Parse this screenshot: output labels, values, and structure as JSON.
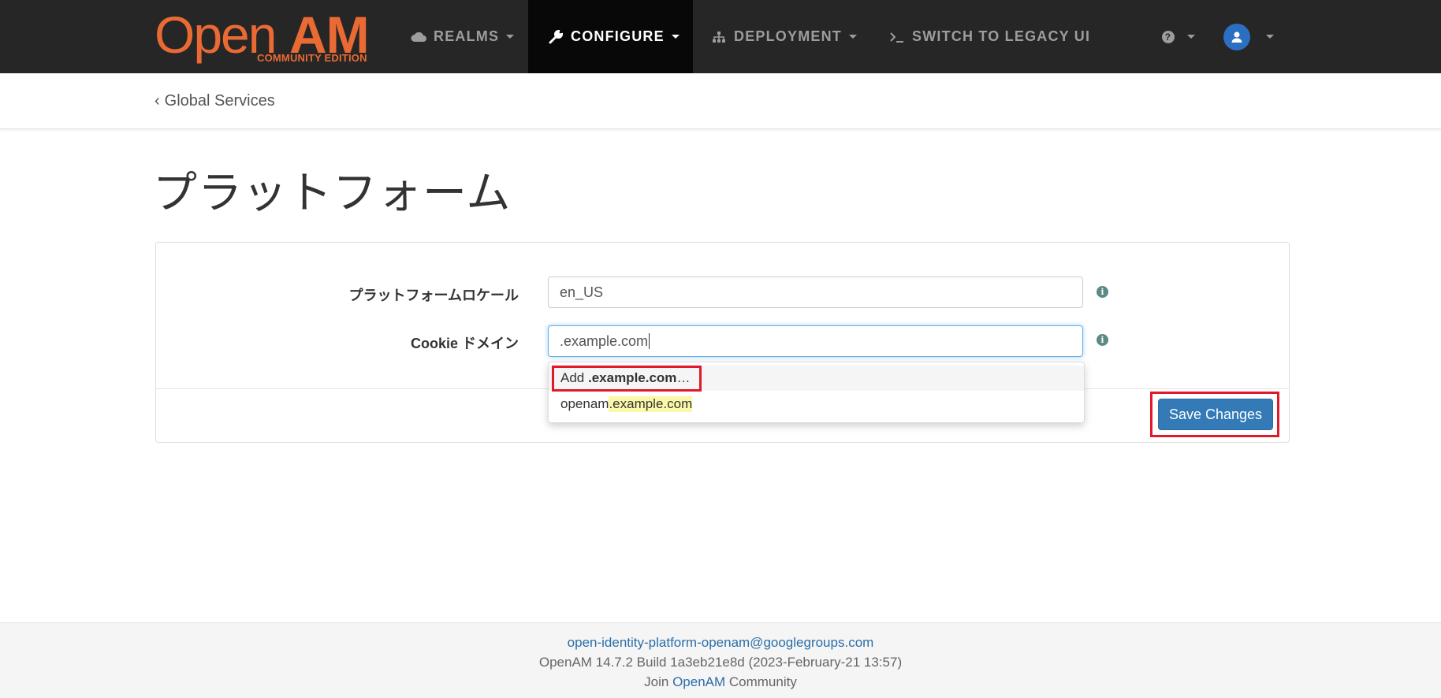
{
  "brand": {
    "open": "Open",
    "am": "AM",
    "edition": "COMMUNITY EDITION"
  },
  "nav": {
    "realms": "REALMS",
    "configure": "CONFIGURE",
    "deployment": "DEPLOYMENT",
    "legacy": "SWITCH TO LEGACY UI"
  },
  "breadcrumb": {
    "back_label": "Global Services"
  },
  "page": {
    "title": "プラットフォーム"
  },
  "form": {
    "locale_label": "プラットフォームロケール",
    "locale_value": "en_US",
    "cookie_label": "Cookie ドメイン",
    "cookie_value": ".example.com"
  },
  "autocomplete": {
    "add_prefix": "Add ",
    "add_value": ".example.com",
    "add_suffix": "…",
    "option_prefix": "openam",
    "option_match": ".example.com"
  },
  "actions": {
    "save_label": "Save Changes"
  },
  "footer": {
    "email": "open-identity-platform-openam@googlegroups.com",
    "build": "OpenAM 14.7.2 Build 1a3eb21e8d (2023-February-21 13:57)",
    "join_prefix": "Join ",
    "join_link": "OpenAM",
    "join_suffix": " Community"
  },
  "colors": {
    "brand": "#ea6a34",
    "navbar": "#262626",
    "primary": "#337ab7",
    "highlight": "#e0192b"
  }
}
